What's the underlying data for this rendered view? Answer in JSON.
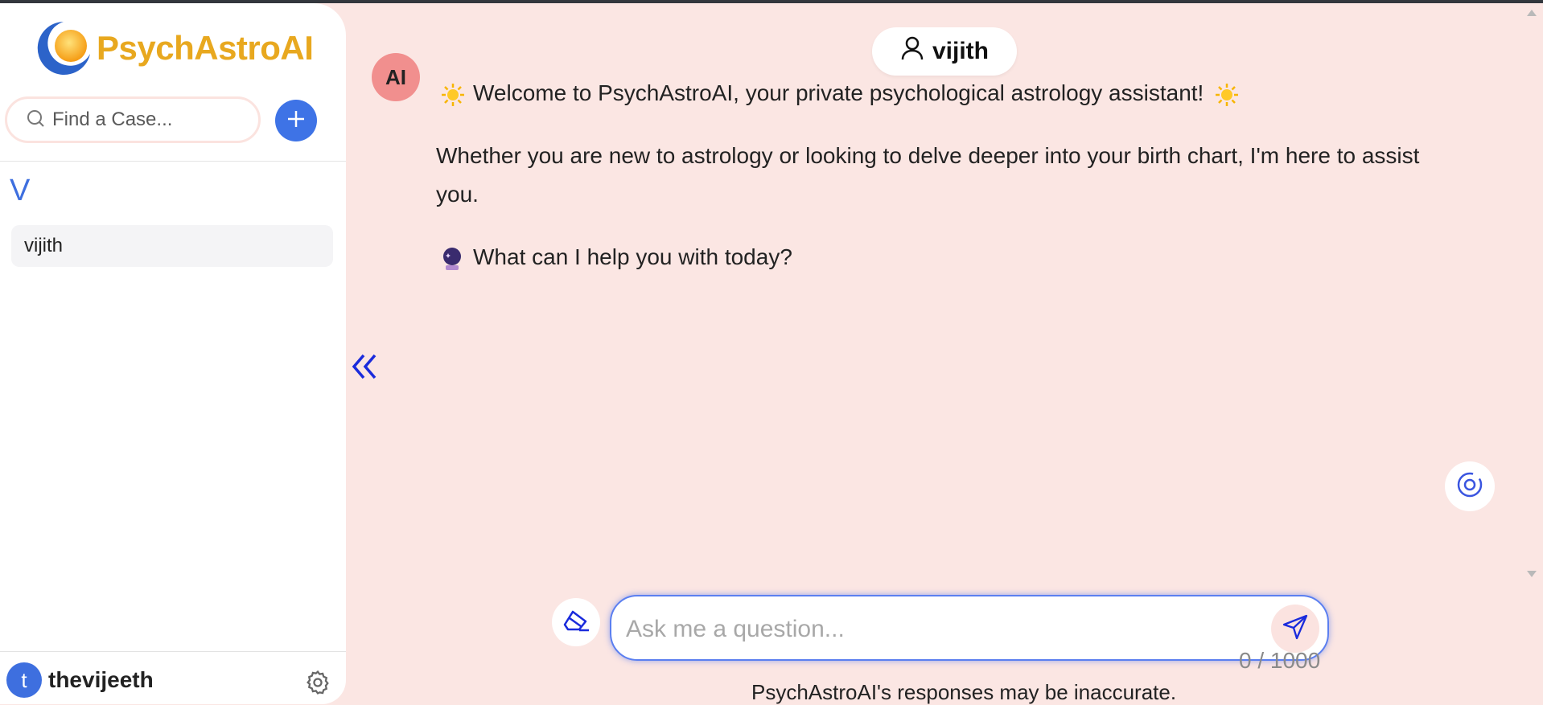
{
  "app": {
    "name": "PsychAstroAI"
  },
  "sidebar": {
    "search": {
      "placeholder": "Find a Case..."
    },
    "groups": [
      {
        "letter": "V",
        "items": [
          {
            "label": "vijith"
          }
        ]
      }
    ],
    "user": {
      "initial": "t",
      "name": "thevijeeth"
    }
  },
  "header": {
    "active_case": "vijith"
  },
  "chat": {
    "assistant_avatar": "AI",
    "messages": [
      "Welcome to PsychAstroAI, your private psychological astrology assistant!",
      "Whether you are new to astrology or looking to delve deeper into your birth chart, I'm here to assist you.",
      "What can I help you with today?"
    ]
  },
  "composer": {
    "placeholder": "Ask me a question...",
    "counter": "0 / 1000",
    "disclaimer": "PsychAstroAI's responses may be inaccurate."
  },
  "icons": [
    "logo-icon",
    "search-icon",
    "plus-icon",
    "gear-icon",
    "user-icon",
    "sun-emoji-icon",
    "crystal-ball-emoji-icon",
    "double-chevron-left-icon",
    "target-icon",
    "eraser-icon",
    "send-icon"
  ],
  "colors": {
    "accent": "#3e73e6",
    "brand": "#e8a81f",
    "background": "#fbe6e3",
    "ai_avatar": "#f18f8e"
  }
}
